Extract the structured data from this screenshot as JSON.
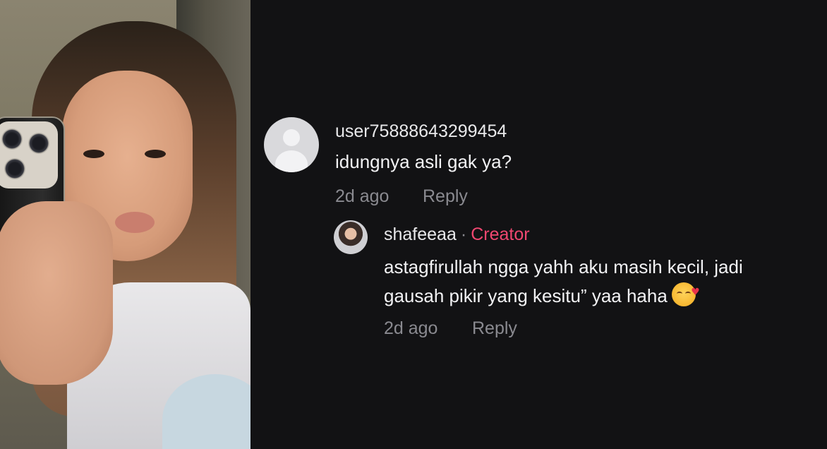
{
  "comments": [
    {
      "username": "user75888643299454",
      "text": "idungnya asli gak ya?",
      "time": "2d ago",
      "reply_label": "Reply",
      "avatar_icon": "default-user-avatar-icon"
    }
  ],
  "reply": {
    "username": "shafeeaa",
    "separator": "·",
    "badge": "Creator",
    "badge_color": "#f04770",
    "text_line1": "astagfirullah ngga yahh aku masih kecil, jadi",
    "text_line2": "gausah pikir yang kesitu” yaa haha",
    "emoji_icon": "smiling-face-with-hearts-icon",
    "time": "2d ago",
    "reply_label": "Reply"
  },
  "colors": {
    "background": "#121214",
    "text": "#f2f2f4",
    "muted": "#8a8a90"
  }
}
